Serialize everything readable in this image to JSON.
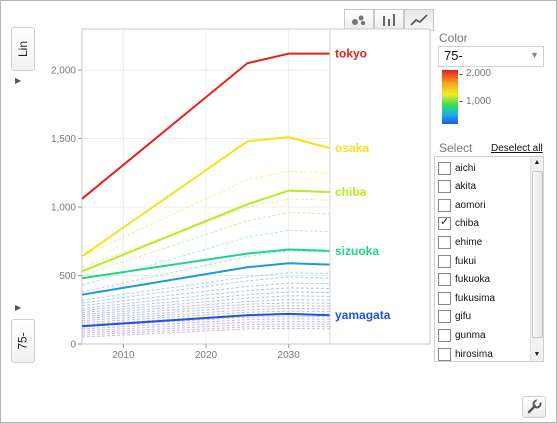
{
  "controls": {
    "y_scale_label": "Lin",
    "x_variable_label": "75-",
    "scale_menu_icon": "triangle-right-icon",
    "x_menu_icon": "triangle-right-icon",
    "chart_types": [
      {
        "icon": "bubble-chart-icon",
        "active": false
      },
      {
        "icon": "bar-chart-icon",
        "active": false
      },
      {
        "icon": "line-chart-icon",
        "active": true
      }
    ],
    "settings_icon": "wrench-icon"
  },
  "color_panel": {
    "title": "Color",
    "selected": "75-",
    "legend_labels": [
      "2,000",
      "1,000"
    ],
    "gradient": [
      "#e02020",
      "#f6a623",
      "#f1ee1c",
      "#35dc5c",
      "#1bb0e6",
      "#2456e8"
    ]
  },
  "select_panel": {
    "title": "Select",
    "deselect_all": "Deselect all",
    "items": [
      {
        "label": "aichi",
        "checked": false
      },
      {
        "label": "akita",
        "checked": false
      },
      {
        "label": "aomori",
        "checked": false
      },
      {
        "label": "chiba",
        "checked": true
      },
      {
        "label": "ehime",
        "checked": false
      },
      {
        "label": "fukui",
        "checked": false
      },
      {
        "label": "fukuoka",
        "checked": false
      },
      {
        "label": "fukusima",
        "checked": false
      },
      {
        "label": "gifu",
        "checked": false
      },
      {
        "label": "gunma",
        "checked": false
      },
      {
        "label": "hirosima",
        "checked": false
      }
    ]
  },
  "chart_data": {
    "type": "line",
    "xlim": [
      2005,
      2035
    ],
    "ylim": [
      0,
      2300
    ],
    "x_ticks": [
      2010,
      2020,
      2030
    ],
    "y_ticks": [
      0,
      500,
      1000,
      1500,
      2000
    ],
    "x_tick_labels": [
      "2010",
      "2020",
      "2030"
    ],
    "y_tick_labels": [
      "0",
      "500",
      "1,000",
      "1,500",
      "2,000"
    ],
    "highlighted_series": [
      {
        "name": "tokyo",
        "color": "#e4241c",
        "x": [
          2005,
          2025,
          2030,
          2035
        ],
        "y": [
          1060,
          2050,
          2120,
          2120
        ]
      },
      {
        "name": "osaka",
        "color": "#f3e41a",
        "x": [
          2005,
          2025,
          2030,
          2035
        ],
        "y": [
          640,
          1480,
          1510,
          1430
        ]
      },
      {
        "name": "chiba",
        "color": "#b7ec1e",
        "x": [
          2005,
          2025,
          2030,
          2035
        ],
        "y": [
          530,
          1020,
          1120,
          1110
        ]
      },
      {
        "name": "sizuoka",
        "color": "#1fd589",
        "x": [
          2005,
          2025,
          2030,
          2035
        ],
        "y": [
          480,
          660,
          690,
          680
        ]
      },
      {
        "name": "yamagata",
        "color": "#1f55dd",
        "x": [
          2005,
          2025,
          2030,
          2035
        ],
        "y": [
          130,
          210,
          220,
          210
        ]
      },
      {
        "color": "#1a9bd7",
        "x": [
          2005,
          2025,
          2030,
          2035
        ],
        "y": [
          360,
          560,
          590,
          580
        ]
      }
    ],
    "faint_series": [
      {
        "color": "#f1ee6a",
        "x": [
          2005,
          2025,
          2030,
          2035
        ],
        "y": [
          640,
          1200,
          1260,
          1250
        ]
      },
      {
        "color": "#d6f07a",
        "x": [
          2005,
          2025,
          2030,
          2035
        ],
        "y": [
          560,
          1000,
          1060,
          1050
        ]
      },
      {
        "color": "#b8ec9a",
        "x": [
          2005,
          2025,
          2030,
          2035
        ],
        "y": [
          500,
          900,
          960,
          950
        ]
      },
      {
        "color": "#9fe3b8",
        "x": [
          2005,
          2025,
          2030,
          2035
        ],
        "y": [
          430,
          780,
          830,
          820
        ]
      },
      {
        "color": "#8cd7cf",
        "x": [
          2005,
          2025,
          2030,
          2035
        ],
        "y": [
          380,
          640,
          680,
          670
        ]
      },
      {
        "color": "#86c7e6",
        "x": [
          2005,
          2025,
          2030,
          2035
        ],
        "y": [
          320,
          490,
          520,
          515
        ]
      },
      {
        "color": "#89bbe9",
        "x": [
          2005,
          2025,
          2030,
          2035
        ],
        "y": [
          300,
          460,
          490,
          480
        ]
      },
      {
        "color": "#8fb2ea",
        "x": [
          2005,
          2025,
          2030,
          2035
        ],
        "y": [
          280,
          420,
          445,
          440
        ]
      },
      {
        "color": "#98aee9",
        "x": [
          2005,
          2025,
          2030,
          2035
        ],
        "y": [
          260,
          390,
          410,
          405
        ]
      },
      {
        "color": "#9aace8",
        "x": [
          2005,
          2025,
          2030,
          2035
        ],
        "y": [
          245,
          360,
          380,
          375
        ]
      },
      {
        "color": "#9ca9e7",
        "x": [
          2005,
          2025,
          2030,
          2035
        ],
        "y": [
          230,
          335,
          352,
          348
        ]
      },
      {
        "color": "#9fa7e6",
        "x": [
          2005,
          2025,
          2030,
          2035
        ],
        "y": [
          215,
          310,
          325,
          320
        ]
      },
      {
        "color": "#a1a6e5",
        "x": [
          2005,
          2025,
          2030,
          2035
        ],
        "y": [
          200,
          290,
          300,
          298
        ]
      },
      {
        "color": "#a4a5e4",
        "x": [
          2005,
          2025,
          2030,
          2035
        ],
        "y": [
          185,
          270,
          280,
          276
        ]
      },
      {
        "color": "#a7a4e3",
        "x": [
          2005,
          2025,
          2030,
          2035
        ],
        "y": [
          170,
          250,
          260,
          256
        ]
      },
      {
        "color": "#a9a3e2",
        "x": [
          2005,
          2025,
          2030,
          2035
        ],
        "y": [
          155,
          232,
          240,
          236
        ]
      },
      {
        "color": "#aca2e1",
        "x": [
          2005,
          2025,
          2030,
          2035
        ],
        "y": [
          140,
          215,
          222,
          218
        ]
      },
      {
        "color": "#afa2e0",
        "x": [
          2005,
          2025,
          2030,
          2035
        ],
        "y": [
          125,
          196,
          202,
          199
        ]
      },
      {
        "color": "#b1a1df",
        "x": [
          2005,
          2025,
          2030,
          2035
        ],
        "y": [
          110,
          178,
          184,
          181
        ]
      },
      {
        "color": "#b4a0de",
        "x": [
          2005,
          2025,
          2030,
          2035
        ],
        "y": [
          95,
          160,
          165,
          162
        ]
      },
      {
        "color": "#b7a0dd",
        "x": [
          2005,
          2025,
          2030,
          2035
        ],
        "y": [
          80,
          142,
          147,
          144
        ]
      },
      {
        "color": "#b9a0dc",
        "x": [
          2005,
          2025,
          2030,
          2035
        ],
        "y": [
          65,
          125,
          130,
          127
        ]
      },
      {
        "color": "#bc9fdb",
        "x": [
          2005,
          2025,
          2030,
          2035
        ],
        "y": [
          50,
          110,
          114,
          111
        ]
      }
    ]
  }
}
